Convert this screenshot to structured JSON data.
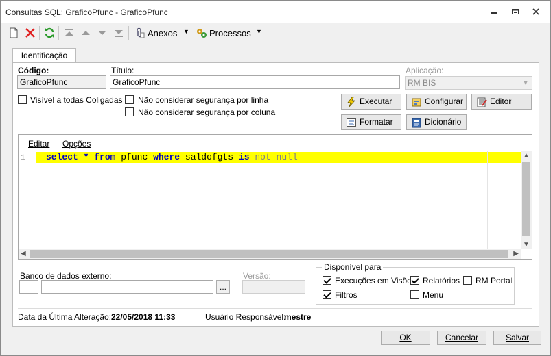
{
  "window": {
    "title": "Consultas SQL: GraficoPfunc - GraficoPfunc"
  },
  "toolbar": {
    "attachments_label": "Anexos",
    "processes_label": "Processos"
  },
  "tabs": [
    {
      "label": "Identificação"
    }
  ],
  "form": {
    "code_label": "Código:",
    "code_value": "GraficoPfunc",
    "title_label": "Título:",
    "title_value": "GraficoPfunc",
    "application_label": "Aplicação:",
    "application_value": "RM BIS",
    "visible_all_label": "Visível a todas Coligadas",
    "no_row_security_label": "Não considerar segurança por linha",
    "no_col_security_label": "Não considerar segurança por coluna"
  },
  "actions": {
    "execute": "Executar",
    "configure": "Configurar",
    "editor": "Editor",
    "format": "Formatar",
    "dictionary": "Dicionário"
  },
  "editor": {
    "menu": [
      "Editar",
      "Opções"
    ],
    "line_number": "1",
    "tokens": [
      {
        "text": "select",
        "cls": "kw"
      },
      {
        "text": " ",
        "cls": "nm"
      },
      {
        "text": "*",
        "cls": "kw"
      },
      {
        "text": " ",
        "cls": "nm"
      },
      {
        "text": "from",
        "cls": "kw"
      },
      {
        "text": " pfunc ",
        "cls": "nm"
      },
      {
        "text": "where",
        "cls": "kw"
      },
      {
        "text": " saldofgts ",
        "cls": "nm"
      },
      {
        "text": "is",
        "cls": "kw"
      },
      {
        "text": " ",
        "cls": "nm"
      },
      {
        "text": "not null",
        "cls": "gr"
      }
    ]
  },
  "external_db": {
    "label": "Banco de dados externo:",
    "button": "...",
    "version_label": "Versão:"
  },
  "availability": {
    "title": "Disponível para",
    "views_label": "Execuções em Visões",
    "reports_label": "Relatórios",
    "portal_label": "RM Portal",
    "filters_label": "Filtros",
    "menu_label": "Menu"
  },
  "info": {
    "last_change_label": "Data da Última Alteração:",
    "last_change_value": "22/05/2018 11:33",
    "user_label": "Usuário Responsável:",
    "user_value": "mestre"
  },
  "footer": {
    "ok": "OK",
    "cancel": "Cancelar",
    "save": "Salvar"
  },
  "colors": {
    "highlight": "#ffff00",
    "keyword": "#0000c0"
  }
}
